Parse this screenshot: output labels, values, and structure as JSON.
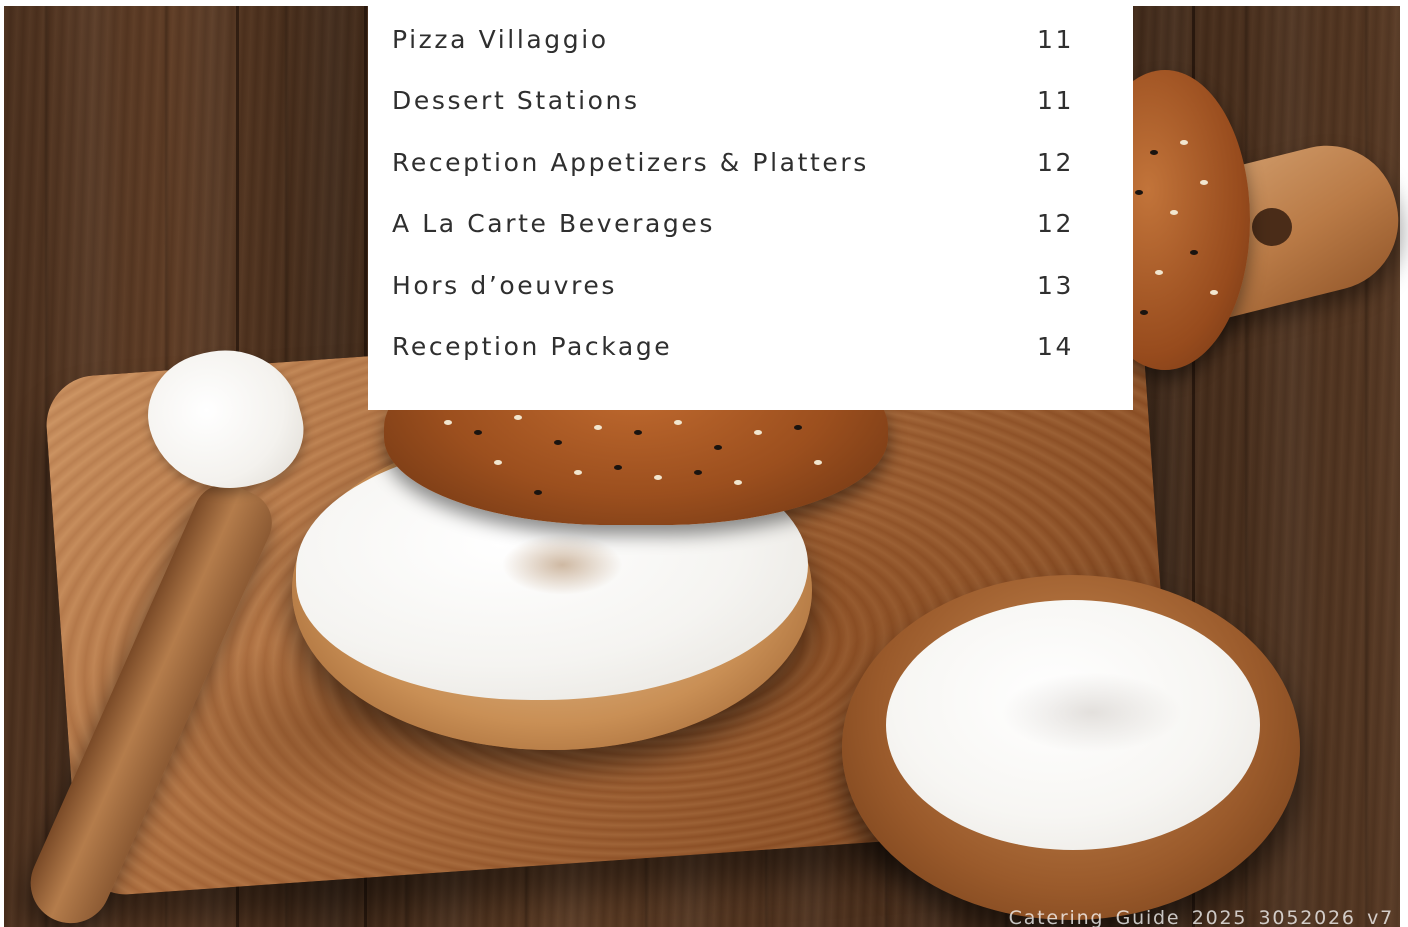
{
  "toc": {
    "entries": [
      {
        "title": "Pizza Villaggio",
        "page": "11"
      },
      {
        "title": "Dessert Stations",
        "page": "11"
      },
      {
        "title": "Reception Appetizers & Platters",
        "page": "12"
      },
      {
        "title": "A La Carte Beverages",
        "page": "12"
      },
      {
        "title": "Hors d’oeuvres",
        "page": "13"
      },
      {
        "title": "Reception Package",
        "page": "14"
      }
    ]
  },
  "footer": {
    "document_code": "Catering_Guide_2025_3052026_v7"
  },
  "colors": {
    "panel_background": "#ffffff",
    "text": "#2f2f2f"
  }
}
